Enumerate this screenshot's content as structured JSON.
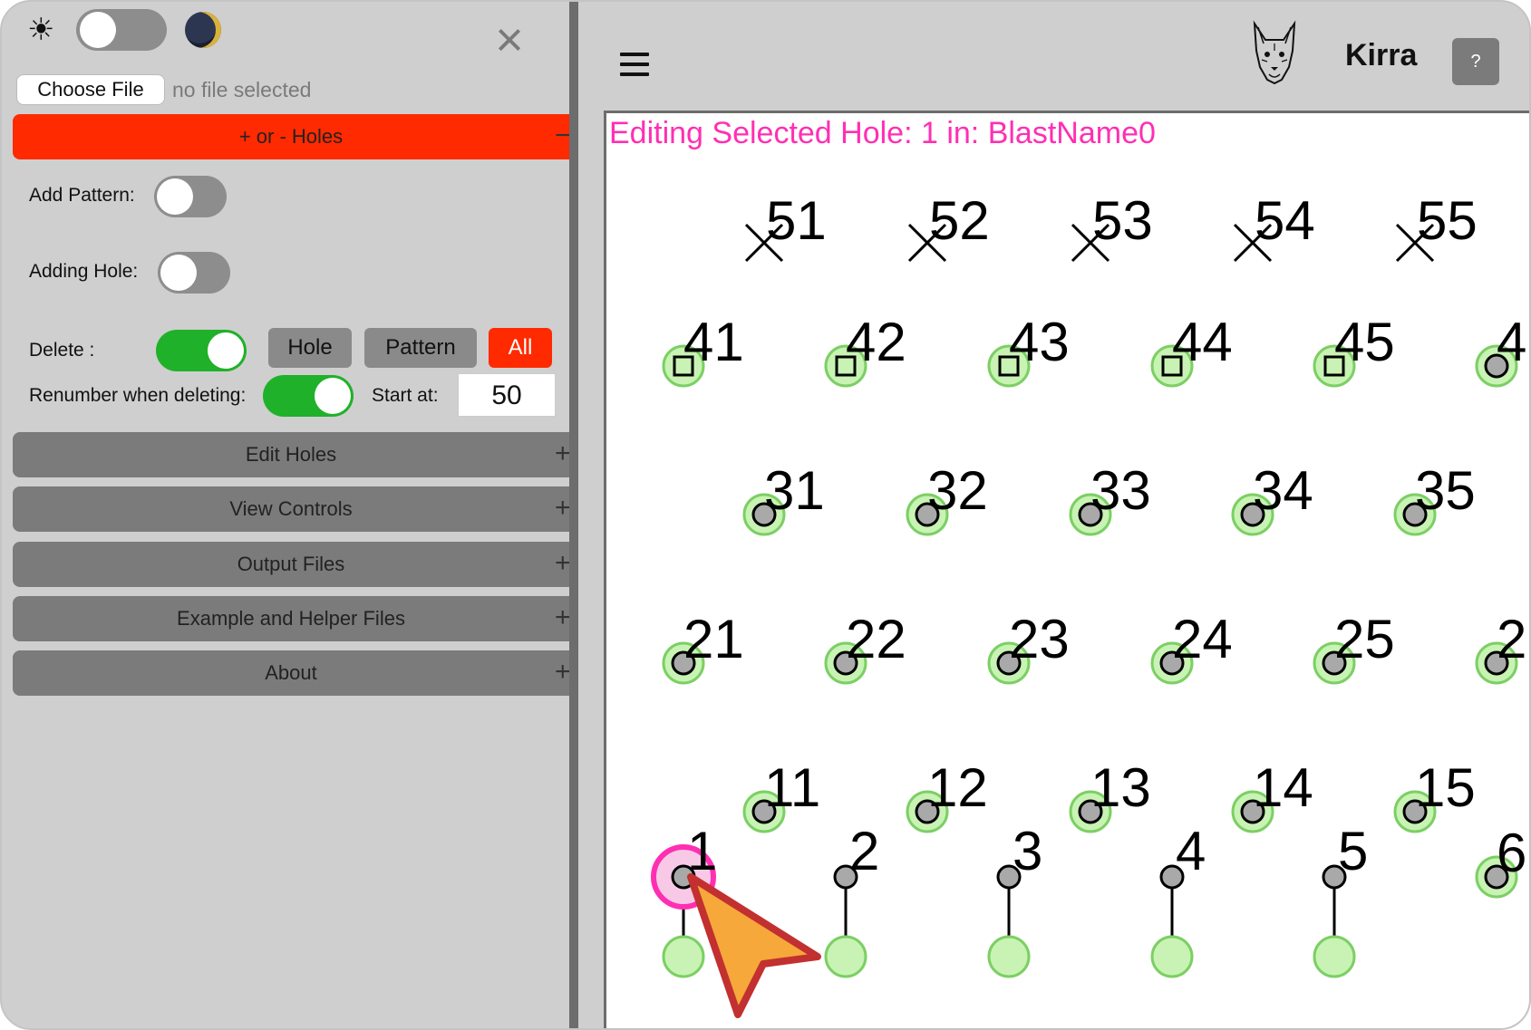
{
  "sidebar": {
    "file_button": "Choose File",
    "file_status": "no file selected",
    "holes_section": {
      "label": "+ or - Holes",
      "sign": "−"
    },
    "add_pattern_label": "Add Pattern:",
    "adding_hole_label": "Adding Hole:",
    "delete_label": "Delete :",
    "delete_buttons": {
      "hole": "Hole",
      "pattern": "Pattern",
      "all": "All"
    },
    "renumber_label": "Renumber when deleting:",
    "start_label": "Start at:",
    "start_value": "50",
    "sections": [
      {
        "label": "Edit Holes",
        "sign": "+"
      },
      {
        "label": "View Controls",
        "sign": "+"
      },
      {
        "label": "Output Files",
        "sign": "+"
      },
      {
        "label": "Example and Helper Files",
        "sign": "+"
      },
      {
        "label": "About",
        "sign": "+"
      }
    ],
    "toggle_states": {
      "theme_dark": false,
      "add_pattern": false,
      "adding_hole": false,
      "delete": true,
      "renumber": true
    }
  },
  "header": {
    "brand": "Kirra",
    "help_label": "?"
  },
  "canvas": {
    "status_text": "Editing Selected Hole: 1 in: BlastName0",
    "holes": [
      {
        "id": "51",
        "kind": "cross",
        "col": 1,
        "row": "top"
      },
      {
        "id": "52",
        "kind": "cross",
        "col": 2,
        "row": "top"
      },
      {
        "id": "53",
        "kind": "cross",
        "col": 3,
        "row": "top"
      },
      {
        "id": "54",
        "kind": "cross",
        "col": 4,
        "row": "top"
      },
      {
        "id": "55",
        "kind": "cross",
        "col": 5,
        "row": "top"
      },
      {
        "id": "41",
        "kind": "square",
        "col": 0,
        "row": "r40"
      },
      {
        "id": "42",
        "kind": "square",
        "col": 1,
        "row": "r40"
      },
      {
        "id": "43",
        "kind": "square",
        "col": 2,
        "row": "r40"
      },
      {
        "id": "44",
        "kind": "square",
        "col": 3,
        "row": "r40"
      },
      {
        "id": "45",
        "kind": "square",
        "col": 4,
        "row": "r40"
      },
      {
        "id": "4",
        "kind": "dot",
        "col": 5,
        "row": "r40"
      },
      {
        "id": "31",
        "kind": "dot",
        "col": 1,
        "row": "r30"
      },
      {
        "id": "32",
        "kind": "dot",
        "col": 2,
        "row": "r30"
      },
      {
        "id": "33",
        "kind": "dot",
        "col": 3,
        "row": "r30"
      },
      {
        "id": "34",
        "kind": "dot",
        "col": 4,
        "row": "r30"
      },
      {
        "id": "35",
        "kind": "dot",
        "col": 5,
        "row": "r30"
      },
      {
        "id": "21",
        "kind": "dot",
        "col": 0,
        "row": "r20"
      },
      {
        "id": "22",
        "kind": "dot",
        "col": 1,
        "row": "r20"
      },
      {
        "id": "23",
        "kind": "dot",
        "col": 2,
        "row": "r20"
      },
      {
        "id": "24",
        "kind": "dot",
        "col": 3,
        "row": "r20"
      },
      {
        "id": "25",
        "kind": "dot",
        "col": 4,
        "row": "r20"
      },
      {
        "id": "2",
        "kind": "dot",
        "col": 5,
        "row": "r20"
      },
      {
        "id": "11",
        "kind": "dot",
        "col": 1,
        "row": "r10"
      },
      {
        "id": "12",
        "kind": "dot",
        "col": 2,
        "row": "r10"
      },
      {
        "id": "13",
        "kind": "dot",
        "col": 3,
        "row": "r10"
      },
      {
        "id": "14",
        "kind": "dot",
        "col": 4,
        "row": "r10"
      },
      {
        "id": "15",
        "kind": "dot",
        "col": 5,
        "row": "r10"
      },
      {
        "id": "1",
        "kind": "collar",
        "col": 0,
        "row": "r0",
        "selected": true
      },
      {
        "id": "2",
        "kind": "collar",
        "col": 1,
        "row": "r0"
      },
      {
        "id": "3",
        "kind": "collar",
        "col": 2,
        "row": "r0"
      },
      {
        "id": "4",
        "kind": "collar",
        "col": 3,
        "row": "r0"
      },
      {
        "id": "5",
        "kind": "collar",
        "col": 4,
        "row": "r0"
      },
      {
        "id": "6",
        "kind": "dot",
        "col": 5,
        "row": "r0"
      }
    ],
    "colors": {
      "hole_fill": "#c8f3b4",
      "hole_stroke": "#7ccf64",
      "collar": "#a9a9a9",
      "selected": "#ff2fb3",
      "status": "#ff2fb3",
      "cursor": "#f6a83a",
      "cursor_outline": "#c23030"
    }
  }
}
